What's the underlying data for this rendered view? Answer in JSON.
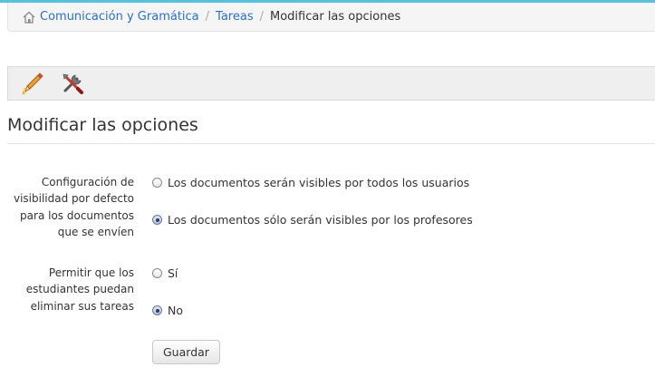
{
  "breadcrumb": {
    "items": [
      "Comunicación y Gramática",
      "Tareas"
    ],
    "separator": "/",
    "current": "Modificar las opciones"
  },
  "toolbar": {
    "icons": [
      "pencil-icon",
      "tools-icon"
    ]
  },
  "page": {
    "title": "Modificar las opciones"
  },
  "form": {
    "visibility": {
      "label_lines": [
        "Configuración de",
        "visibilidad por defecto",
        "para los documentos",
        "que se envíen"
      ],
      "options": [
        {
          "label": "Los documentos serán visibles por todos los usuarios",
          "checked": false
        },
        {
          "label": "Los documentos sólo serán visibles por los profesores",
          "checked": true
        }
      ]
    },
    "delete": {
      "label_lines": [
        "Permitir que los",
        "estudiantes puedan",
        "eliminar sus tareas"
      ],
      "options": [
        {
          "label": "Sí",
          "checked": false
        },
        {
          "label": "No",
          "checked": true
        }
      ]
    },
    "submit_label": "Guardar"
  },
  "colors": {
    "link": "#2a6fc9",
    "accent_bar": "#5bc0de"
  }
}
